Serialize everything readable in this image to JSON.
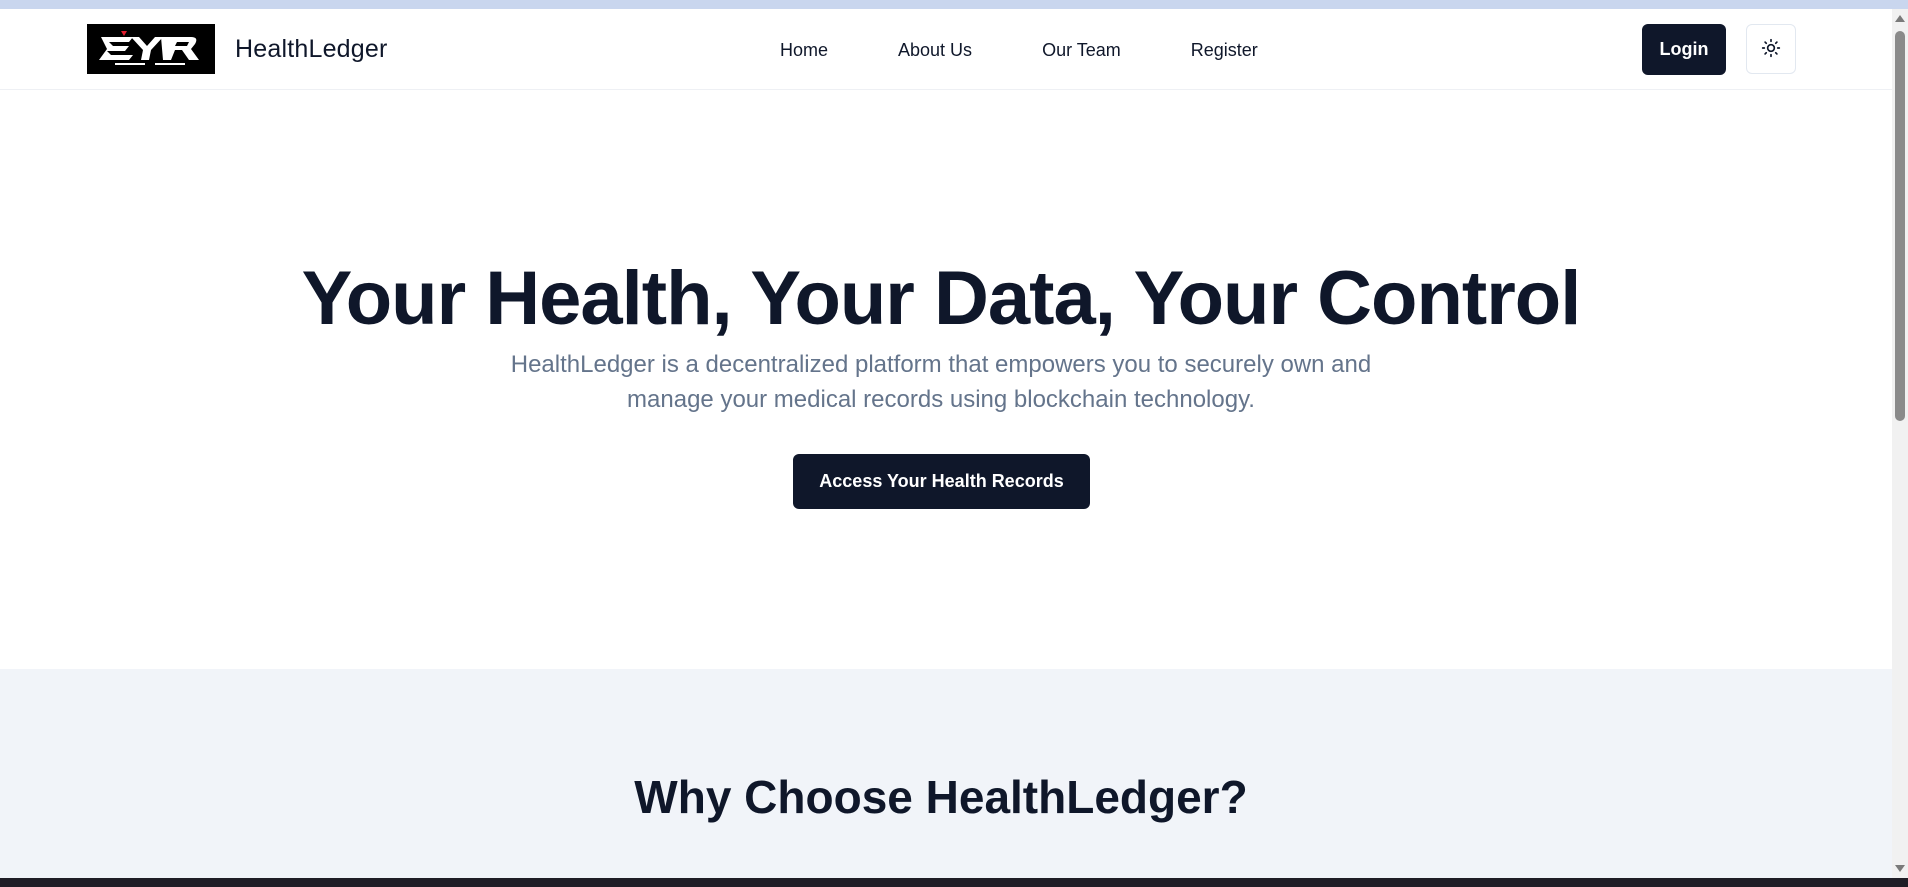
{
  "brand": {
    "name": "HealthLedger",
    "logo_icon": "eyr-logo-icon"
  },
  "nav": {
    "items": [
      {
        "label": "Home"
      },
      {
        "label": "About Us"
      },
      {
        "label": "Our Team"
      },
      {
        "label": "Register"
      }
    ]
  },
  "header": {
    "login_label": "Login",
    "theme_icon": "sun-icon"
  },
  "hero": {
    "title": "Your Health, Your Data, Your Control",
    "subtitle": "HealthLedger is a decentralized platform that empowers you to securely own and manage your medical records using blockchain technology.",
    "cta_label": "Access Your Health Records"
  },
  "features": {
    "title": "Why Choose HealthLedger?"
  },
  "colors": {
    "primary": "#0f172a",
    "muted_text": "#64748b",
    "section_bg": "#f1f4f9"
  }
}
